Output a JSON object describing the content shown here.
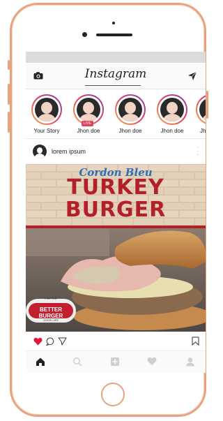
{
  "app": {
    "title": "Instagram"
  },
  "stories": [
    {
      "label": "Your Story",
      "live": false
    },
    {
      "label": "Jhon doe",
      "live": true,
      "badge": "LIVE"
    },
    {
      "label": "Jhon doe",
      "live": false
    },
    {
      "label": "Jhon doe",
      "live": false
    },
    {
      "label": "Jh",
      "live": false
    }
  ],
  "post": {
    "username": "lorem ipsum",
    "image": {
      "headline_top": "Cordon Bleu",
      "headline_1": "TURKEY",
      "headline_2": "BURGER",
      "brand_1": "BETTER BURGER",
      "brand_small_top": "FOR THE",
      "brand_small_bottom": "GOOD LIFE"
    },
    "liked": true
  },
  "icons": {
    "camera": "camera-icon",
    "send": "send-icon",
    "heart": "heart-icon",
    "comment": "comment-icon",
    "share": "share-icon",
    "bookmark": "bookmark-icon",
    "home": "home-icon",
    "search": "search-icon",
    "add": "add-icon",
    "activity": "activity-icon",
    "profile": "profile-icon"
  },
  "colors": {
    "frame": "#e8a37c",
    "like": "#e0173a",
    "headline": "#b3202a",
    "subtitle": "#2f6fb3"
  }
}
